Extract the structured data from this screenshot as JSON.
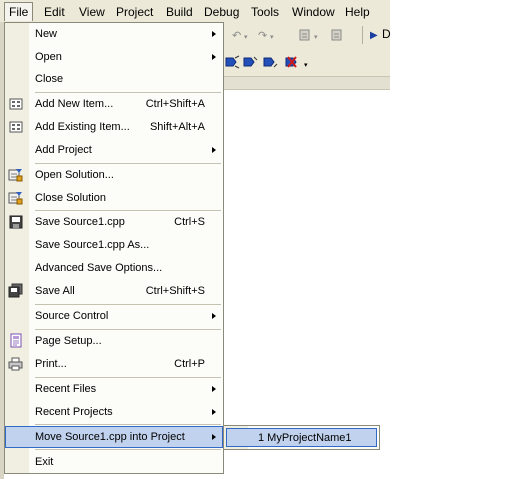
{
  "menubar": {
    "items": [
      "File",
      "Edit",
      "View",
      "Project",
      "Build",
      "Debug",
      "Tools",
      "Window",
      "Help"
    ]
  },
  "toolbar": {
    "icons": [
      "undo-icon",
      "redo-icon",
      "navigate-back-icon",
      "navigate-forward-icon",
      "start-debug-icon",
      "bookmark-icon",
      "bookmark-next-icon",
      "bookmark-prev-icon",
      "bookmark-clear-icon"
    ],
    "partial_label": "D"
  },
  "file_menu": {
    "items": [
      {
        "label": "New",
        "shortcut": "",
        "submenu": true
      },
      {
        "label": "Open",
        "shortcut": "",
        "submenu": true
      },
      {
        "label": "Close",
        "shortcut": "",
        "submenu": false
      },
      {
        "label": "Add New Item...",
        "shortcut": "Ctrl+Shift+A",
        "submenu": false,
        "icon": "add-new-item-icon"
      },
      {
        "label": "Add Existing Item...",
        "shortcut": "Shift+Alt+A",
        "submenu": false,
        "icon": "add-existing-item-icon"
      },
      {
        "label": "Add Project",
        "shortcut": "",
        "submenu": true
      },
      {
        "label": "Open Solution...",
        "shortcut": "",
        "submenu": false,
        "icon": "open-solution-icon"
      },
      {
        "label": "Close Solution",
        "shortcut": "",
        "submenu": false,
        "icon": "close-solution-icon"
      },
      {
        "label": "Save Source1.cpp",
        "shortcut": "Ctrl+S",
        "submenu": false,
        "icon": "save-icon"
      },
      {
        "label": "Save Source1.cpp As...",
        "shortcut": "",
        "submenu": false
      },
      {
        "label": "Advanced Save Options...",
        "shortcut": "",
        "submenu": false
      },
      {
        "label": "Save All",
        "shortcut": "Ctrl+Shift+S",
        "submenu": false,
        "icon": "save-all-icon"
      },
      {
        "label": "Source Control",
        "shortcut": "",
        "submenu": true
      },
      {
        "label": "Page Setup...",
        "shortcut": "",
        "submenu": false,
        "icon": "page-setup-icon"
      },
      {
        "label": "Print...",
        "shortcut": "Ctrl+P",
        "submenu": false,
        "icon": "print-icon"
      },
      {
        "label": "Recent Files",
        "shortcut": "",
        "submenu": true
      },
      {
        "label": "Recent Projects",
        "shortcut": "",
        "submenu": true
      },
      {
        "label": "Move Source1.cpp into Project",
        "shortcut": "",
        "submenu": true,
        "highlighted": true
      },
      {
        "label": "Exit",
        "shortcut": "",
        "submenu": false
      }
    ]
  },
  "submenu": {
    "items": [
      {
        "label": "1 MyProjectName1",
        "highlighted": true
      }
    ]
  },
  "colors": {
    "menubar_bg": "#ece9d8",
    "menu_bg": "#fcfcf9",
    "gutter_bg": "#f1efe2",
    "highlight_bg": "#c1d2ee",
    "highlight_border": "#316ac5"
  }
}
